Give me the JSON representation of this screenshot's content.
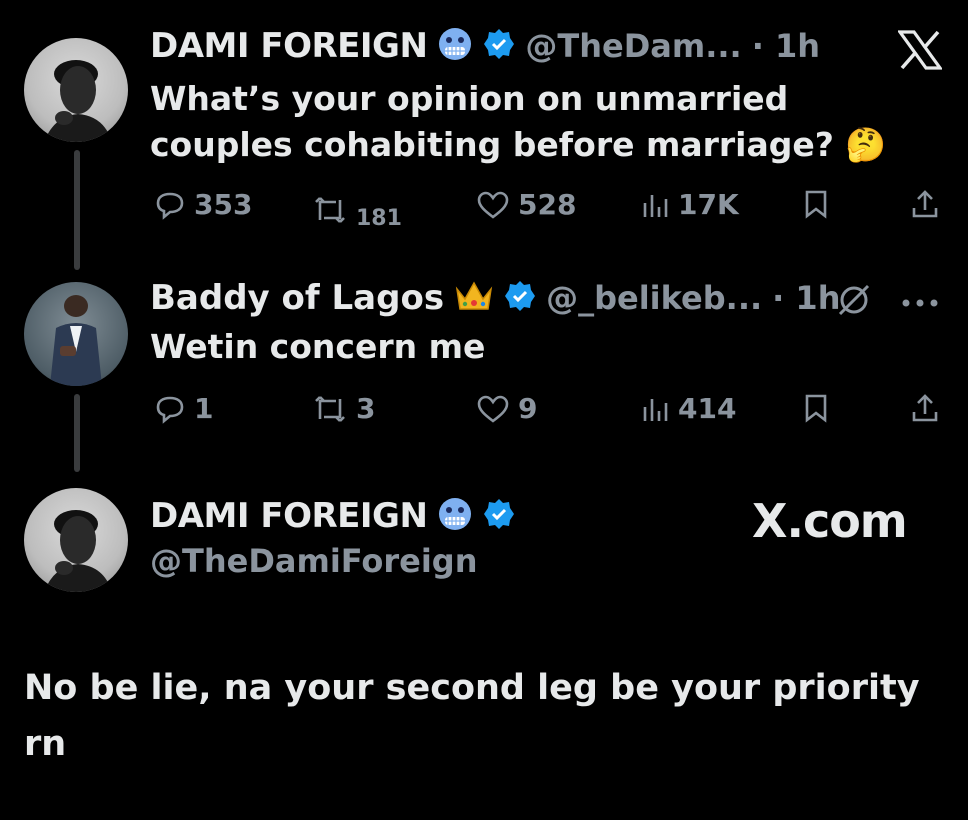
{
  "tweet1": {
    "name": "DAMI FOREIGN",
    "handle": "@TheDam...",
    "time": "· 1h",
    "text": "What’s your opinion on unmarried couples cohabiting before marriage?",
    "emoji": "🤔",
    "stats": {
      "replies": "353",
      "reposts": "181",
      "likes": "528",
      "views": "17K"
    }
  },
  "tweet2": {
    "name": "Baddy of Lagos",
    "handle": "@_belikeb...",
    "time": "· 1h",
    "text": "Wetin concern me",
    "stats": {
      "replies": "1",
      "reposts": "3",
      "likes": "9",
      "views": "414"
    }
  },
  "tweet3": {
    "name": "DAMI FOREIGN",
    "handle": "@TheDamiForeign",
    "text": "No be lie, na your second leg be your priority rn"
  },
  "watermark": "X.com",
  "colors": {
    "background": "#000000",
    "text": "#e7e9ea",
    "muted": "#8b949e",
    "verified": "#1d9bf0",
    "line": "#3a3c3e"
  }
}
